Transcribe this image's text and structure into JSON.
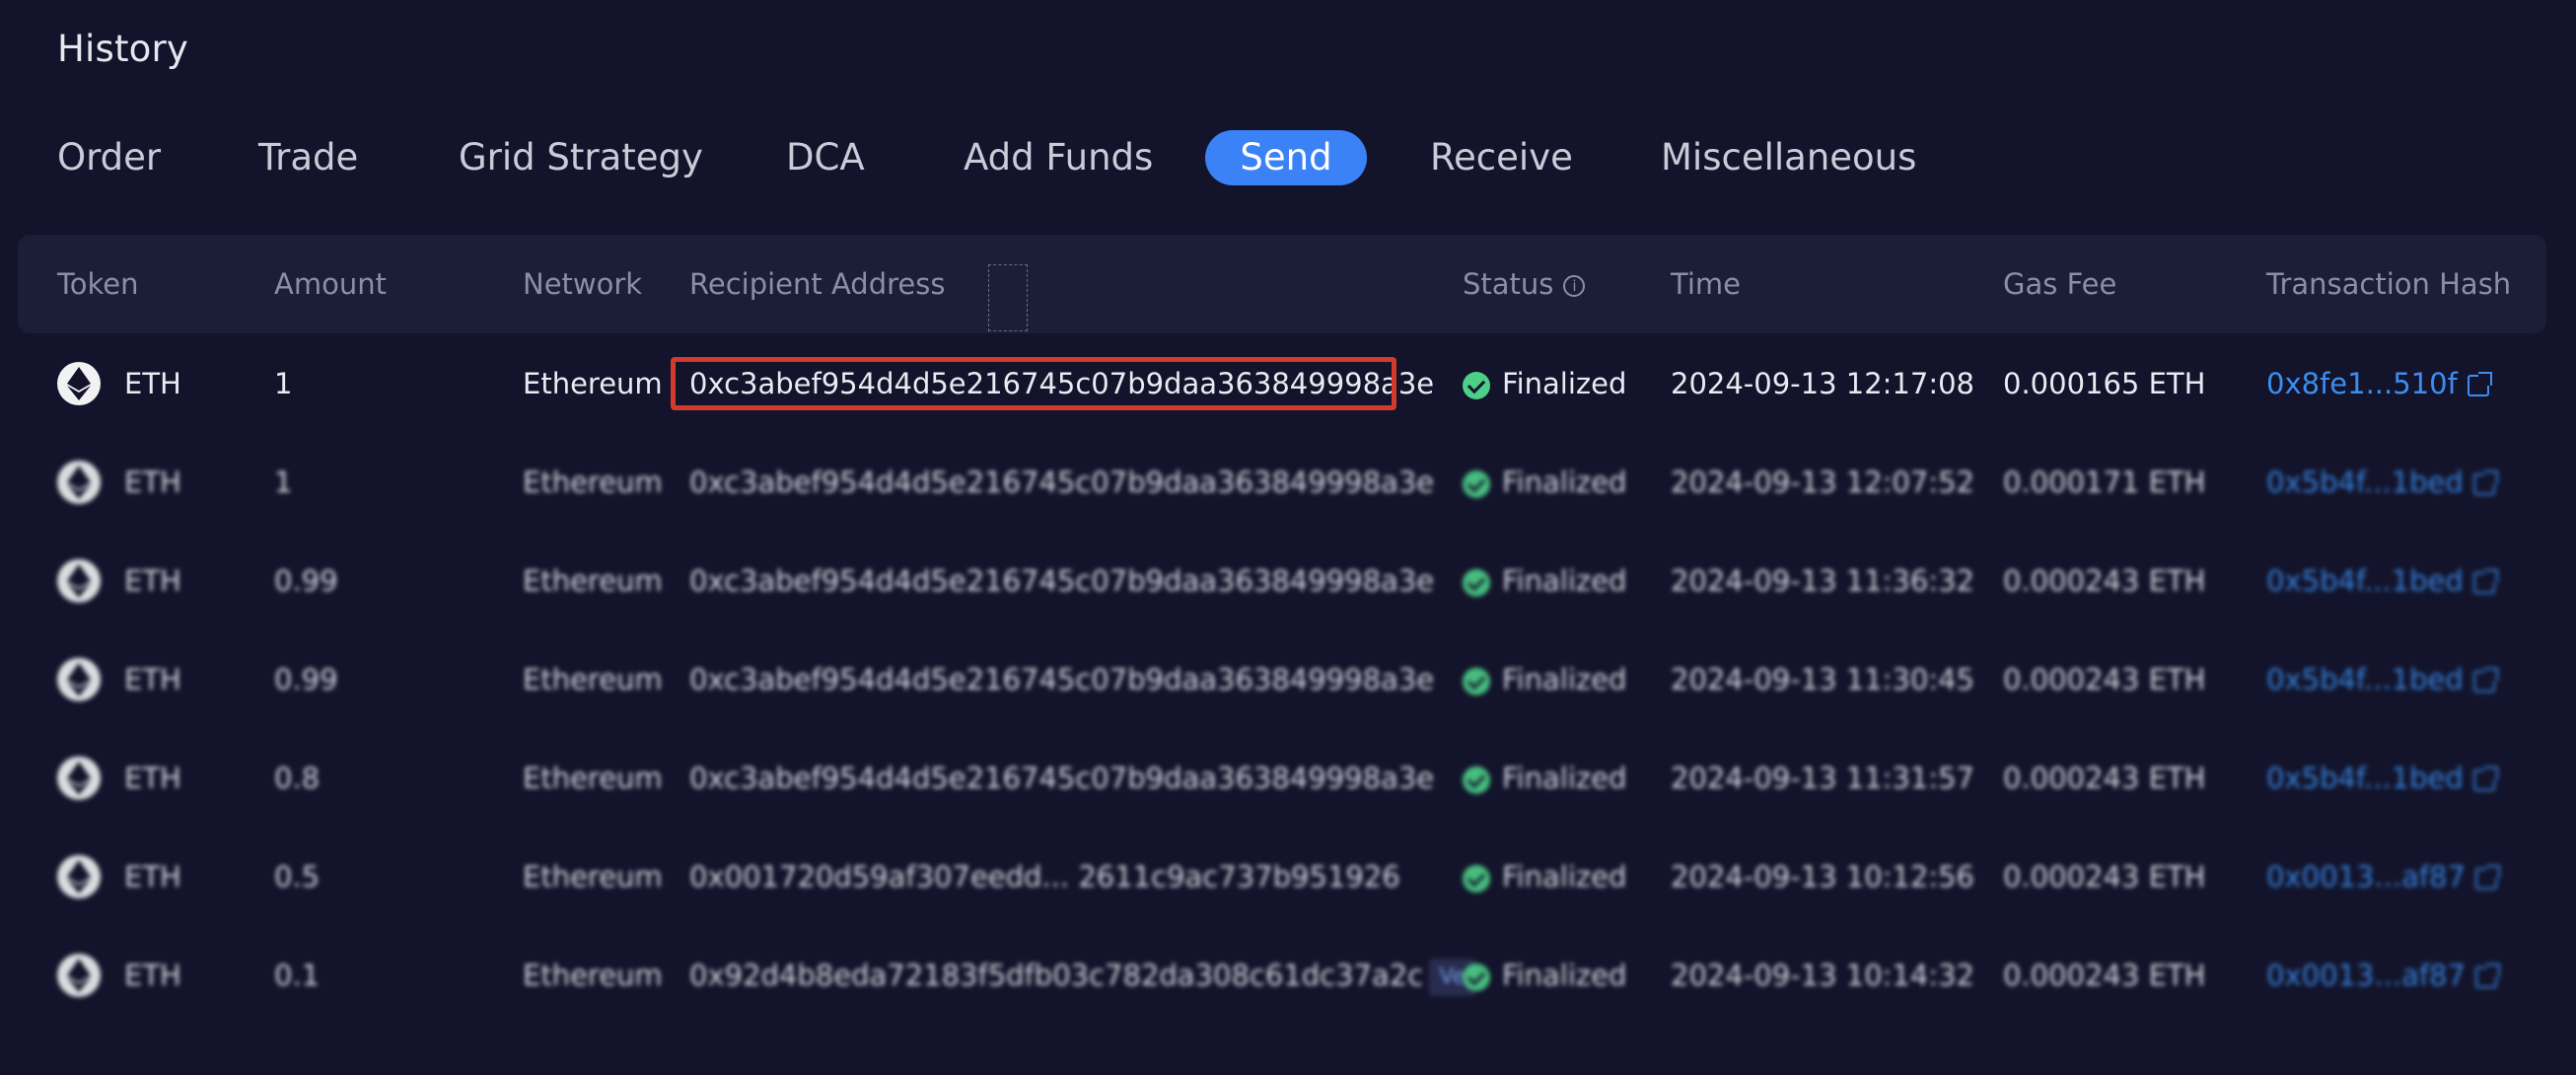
{
  "page": {
    "title": "History"
  },
  "tabs": [
    {
      "label": "Order"
    },
    {
      "label": "Trade"
    },
    {
      "label": "Grid Strategy"
    },
    {
      "label": "DCA"
    },
    {
      "label": "Add Funds"
    },
    {
      "label": "Send",
      "active": true
    },
    {
      "label": "Receive"
    },
    {
      "label": "Miscellaneous"
    }
  ],
  "table": {
    "headers": {
      "token": "Token",
      "amount": "Amount",
      "network": "Network",
      "recipient": "Recipient Address",
      "status": "Status",
      "status_info_icon": "i",
      "time": "Time",
      "gas_fee": "Gas Fee",
      "tx_hash": "Transaction Hash"
    },
    "rows": [
      {
        "token": "ETH",
        "amount": "1",
        "network": "Ethereum",
        "recipient": "0xc3abef954d4d5e216745c07b9daa363849998a3e",
        "status": "Finalized",
        "time": "2024-09-13 12:17:08",
        "gas_fee": "0.000165 ETH",
        "tx_hash": "0x8fe1...510f",
        "highlighted": true
      },
      {
        "token": "ETH",
        "amount": "1",
        "network": "Ethereum",
        "recipient": "0xc3abef954d4d5e216745c07b9daa363849998a3e",
        "status": "Finalized",
        "time": "2024-09-13 12:07:52",
        "gas_fee": "0.000171 ETH",
        "tx_hash": "0x5b4f...1bed",
        "blurred": true
      },
      {
        "token": "ETH",
        "amount": "0.99",
        "network": "Ethereum",
        "recipient": "0xc3abef954d4d5e216745c07b9daa363849998a3e",
        "status": "Finalized",
        "time": "2024-09-13 11:36:32",
        "gas_fee": "0.000243 ETH",
        "tx_hash": "0x5b4f...1bed",
        "blurred": true
      },
      {
        "token": "ETH",
        "amount": "0.99",
        "network": "Ethereum",
        "recipient": "0xc3abef954d4d5e216745c07b9daa363849998a3e",
        "status": "Finalized",
        "time": "2024-09-13 11:30:45",
        "gas_fee": "0.000243 ETH",
        "tx_hash": "0x5b4f...1bed",
        "blurred": true
      },
      {
        "token": "ETH",
        "amount": "0.8",
        "network": "Ethereum",
        "recipient": "0xc3abef954d4d5e216745c07b9daa363849998a3e",
        "status": "Finalized",
        "time": "2024-09-13 11:31:57",
        "gas_fee": "0.000243 ETH",
        "tx_hash": "0x5b4f...1bed",
        "blurred": true
      },
      {
        "token": "ETH",
        "amount": "0.5",
        "network": "Ethereum",
        "recipient": "0x001720d59af307eedd... 2611c9ac737b951926",
        "status": "Finalized",
        "time": "2024-09-13 10:12:56",
        "gas_fee": "0.000243 ETH",
        "tx_hash": "0x0013...af87",
        "blurred": true
      },
      {
        "token": "ETH",
        "amount": "0.1",
        "network": "Ethereum",
        "recipient": "0x92d4b8eda72183f5dfb03c782da308c61dc37a2c",
        "recipient_badge": "Ve",
        "status": "Finalized",
        "time": "2024-09-13 10:14:32",
        "gas_fee": "0.000243 ETH",
        "tx_hash": "0x0013...af87",
        "blurred": true
      }
    ]
  },
  "colors": {
    "background": "#13142b",
    "header_bg": "#1c1d36",
    "accent": "#3b82f6",
    "status_ok": "#4ccf87",
    "link": "#3b8ef0",
    "highlight_border": "#d23a2c"
  }
}
